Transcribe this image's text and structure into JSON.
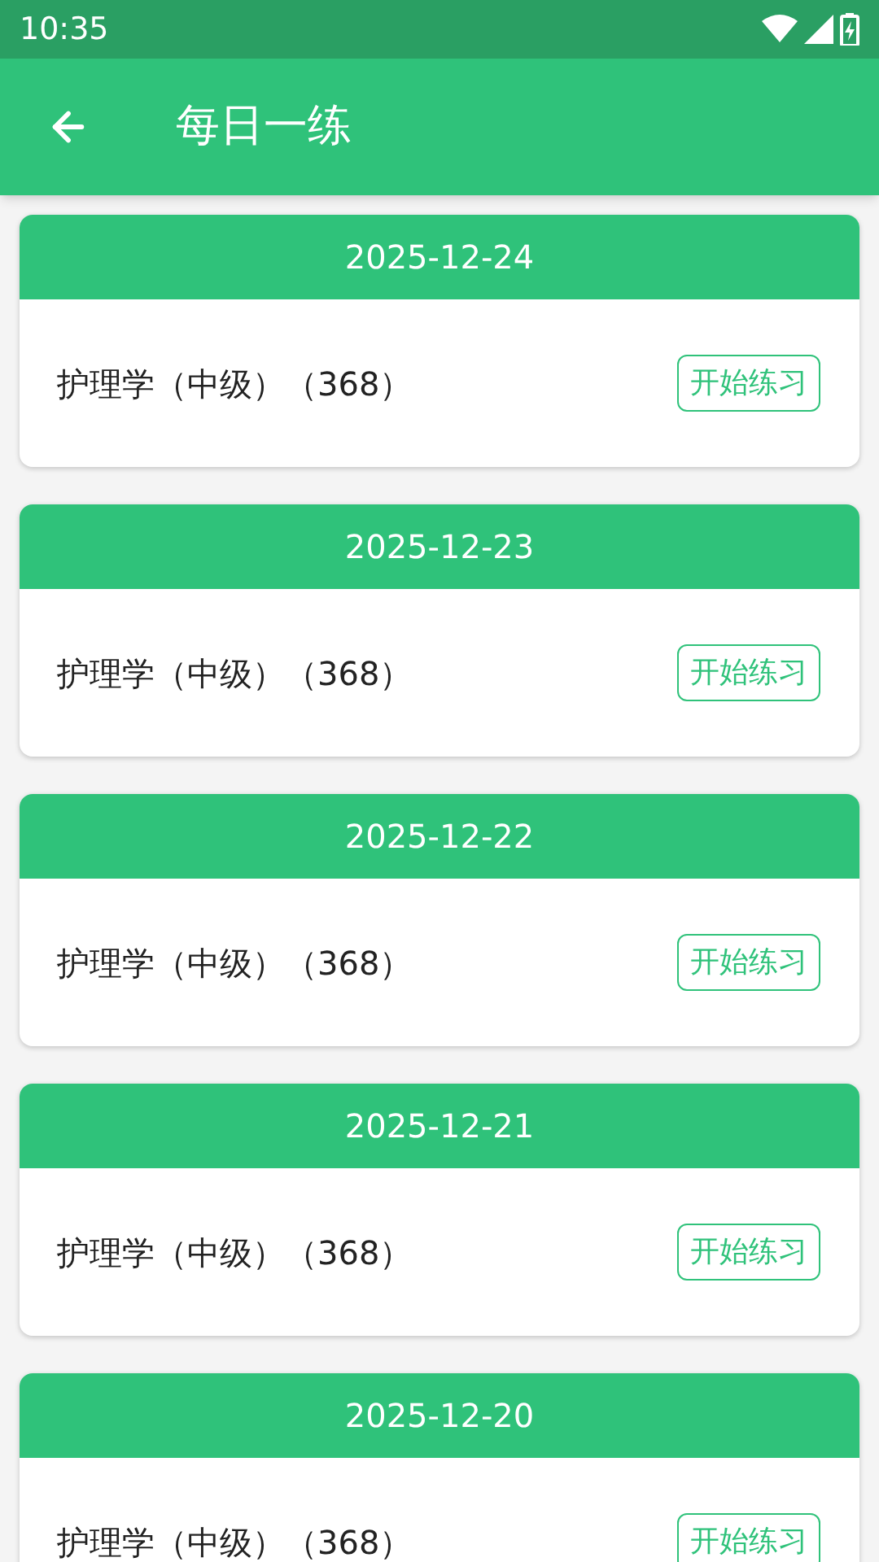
{
  "status_bar": {
    "time": "10:35"
  },
  "app_bar": {
    "title": "每日一练"
  },
  "cards": [
    {
      "date": "2025-12-24",
      "subject": "护理学（中级）（368）",
      "button": "开始练习"
    },
    {
      "date": "2025-12-23",
      "subject": "护理学（中级）（368）",
      "button": "开始练习"
    },
    {
      "date": "2025-12-22",
      "subject": "护理学（中级）（368）",
      "button": "开始练习"
    },
    {
      "date": "2025-12-21",
      "subject": "护理学（中级）（368）",
      "button": "开始练习"
    },
    {
      "date": "2025-12-20",
      "subject": "护理学（中级）（368）",
      "button": "开始练习"
    }
  ]
}
